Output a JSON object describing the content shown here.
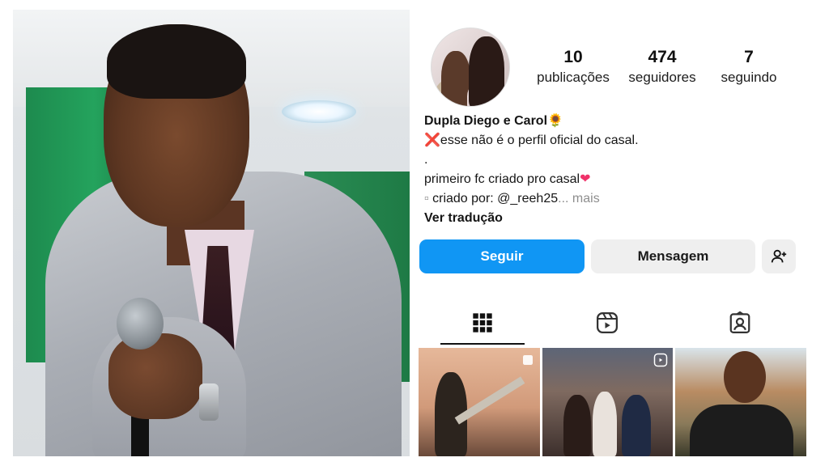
{
  "profile": {
    "stats": [
      {
        "number": "10",
        "label": "publicações"
      },
      {
        "number": "474",
        "label": "seguidores"
      },
      {
        "number": "7",
        "label": "seguindo"
      }
    ],
    "name": "Dupla Diego e Carol",
    "name_emoji": "🌻",
    "bio_line1_icon": "❌",
    "bio_line1": "esse não é o perfil oficial do casal.",
    "bio_line2": ".",
    "bio_line3": "primeiro fc criado pro casal",
    "bio_line3_emoji": "❤",
    "bio_line4_bullet": "▫",
    "bio_line4": " criado por: @_reeh25",
    "bio_more": "... mais",
    "translate": "Ver tradução"
  },
  "buttons": {
    "follow": "Seguir",
    "message": "Mensagem",
    "add_user_icon": "add-person-icon"
  },
  "tabs": [
    {
      "icon": "grid-icon",
      "active": true
    },
    {
      "icon": "reels-icon",
      "active": false
    },
    {
      "icon": "tagged-icon",
      "active": false
    }
  ],
  "posts": [
    {
      "type": "carousel",
      "badge_icon": "multiple-icon"
    },
    {
      "type": "reel",
      "badge_icon": "reel-icon"
    },
    {
      "type": "photo",
      "badge_icon": ""
    }
  ],
  "colors": {
    "follow_button": "#1096f4",
    "secondary_button": "#efefef"
  }
}
